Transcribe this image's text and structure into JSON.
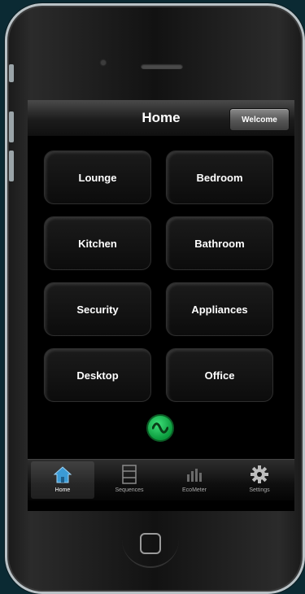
{
  "navbar": {
    "title": "Home",
    "welcome_label": "Welcome"
  },
  "rooms": [
    {
      "label": "Lounge"
    },
    {
      "label": "Bedroom"
    },
    {
      "label": "Kitchen"
    },
    {
      "label": "Bathroom"
    },
    {
      "label": "Security"
    },
    {
      "label": "Appliances"
    },
    {
      "label": "Desktop"
    },
    {
      "label": "Office"
    }
  ],
  "status": {
    "icon": "power-on-icon",
    "color": "#22c55e"
  },
  "tabbar": {
    "active": "Home",
    "tabs": [
      {
        "label": "Home",
        "icon": "home-icon"
      },
      {
        "label": "Sequences",
        "icon": "film-strip-icon"
      },
      {
        "label": "EcoMeter",
        "icon": "bar-chart-icon"
      },
      {
        "label": "Settings",
        "icon": "gear-icon"
      }
    ]
  },
  "colors": {
    "accent": "#3b9bd6",
    "background": "#000000",
    "page_bg": "#0b2a33"
  }
}
